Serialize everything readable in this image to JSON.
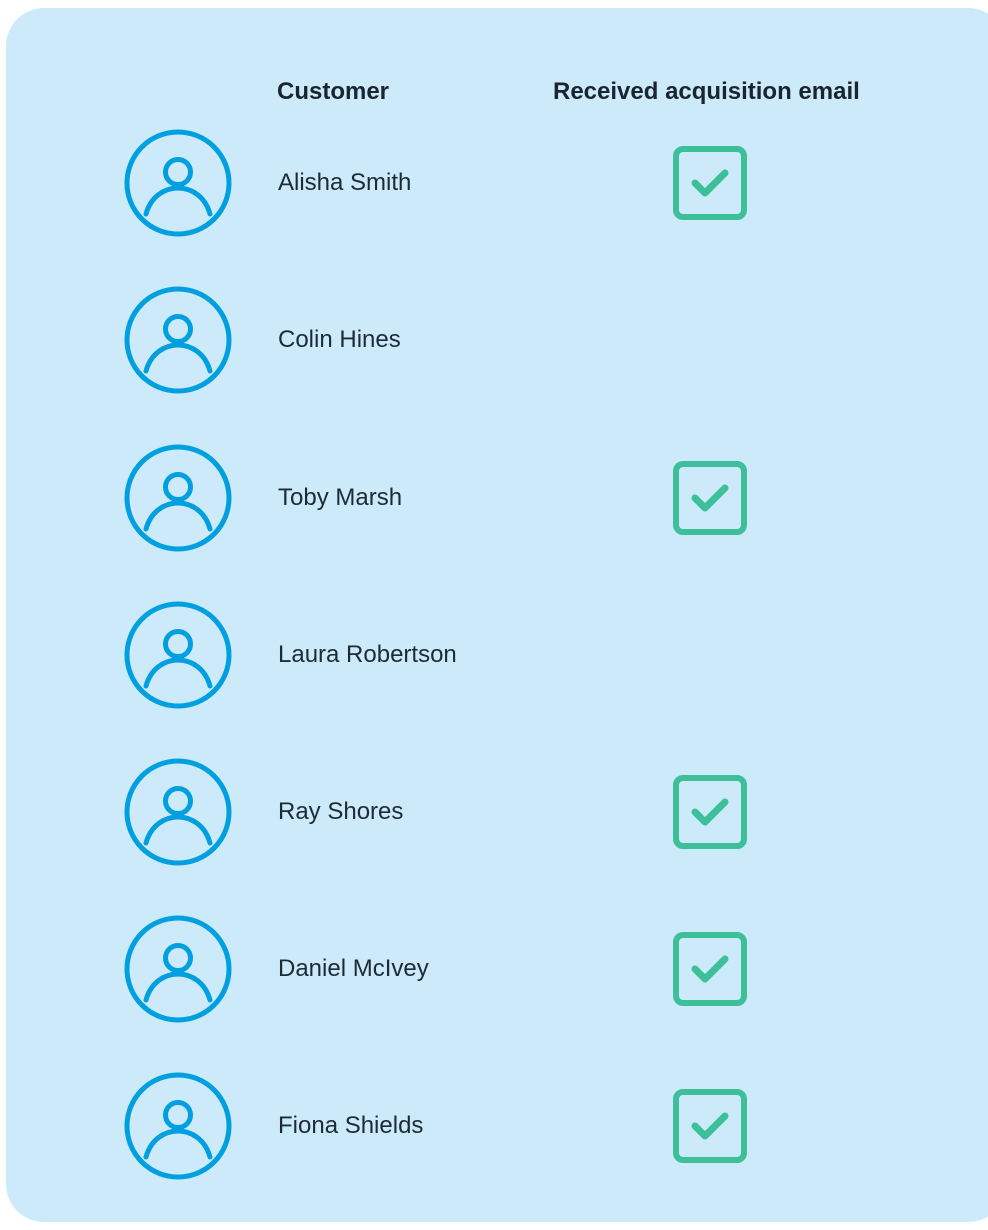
{
  "table": {
    "headers": {
      "customer": "Customer",
      "received": "Received acquisition email"
    },
    "rows": [
      {
        "name": "Alisha Smith",
        "received": true
      },
      {
        "name": "Colin Hines",
        "received": false
      },
      {
        "name": "Toby Marsh",
        "received": true
      },
      {
        "name": "Laura Robertson",
        "received": false
      },
      {
        "name": "Ray Shores",
        "received": true
      },
      {
        "name": "Daniel McIvey",
        "received": true
      },
      {
        "name": "Fiona Shields",
        "received": true
      }
    ]
  },
  "colors": {
    "card_background": "#cceaf9",
    "avatar_icon": "#009fdf",
    "check_icon": "#3dbf9a",
    "text": "#1d2b36"
  },
  "icons": {
    "avatar": "user-avatar-icon",
    "check": "checkbox-checked-icon"
  }
}
